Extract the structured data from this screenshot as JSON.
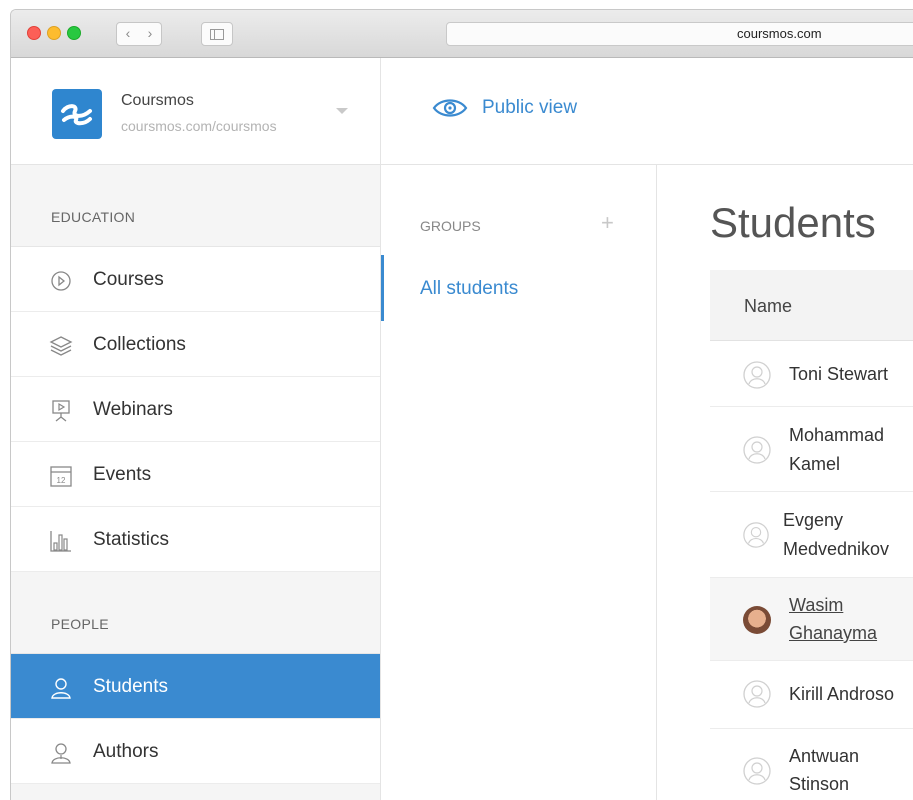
{
  "browser": {
    "url": "coursmos.com",
    "back_glyph": "‹",
    "forward_glyph": "›"
  },
  "brand": {
    "name": "Coursmos",
    "url": "coursmos.com/coursmos",
    "logo_color": "#2f86cf"
  },
  "topbar": {
    "public_view_label": "Public view"
  },
  "sidebar": {
    "sections": [
      {
        "title": "EDUCATION",
        "items": [
          {
            "label": "Courses",
            "icon": "play-circle-icon"
          },
          {
            "label": "Collections",
            "icon": "layers-icon"
          },
          {
            "label": "Webinars",
            "icon": "presentation-icon"
          },
          {
            "label": "Events",
            "icon": "calendar-icon",
            "calendar_day": "12"
          },
          {
            "label": "Statistics",
            "icon": "bar-chart-icon"
          }
        ]
      },
      {
        "title": "PEOPLE",
        "items": [
          {
            "label": "Students",
            "icon": "user-icon",
            "active": true
          },
          {
            "label": "Authors",
            "icon": "author-icon"
          }
        ]
      }
    ]
  },
  "groups": {
    "heading": "GROUPS",
    "add_glyph": "+",
    "items": [
      {
        "label": "All students",
        "active": true
      }
    ]
  },
  "students": {
    "title": "Students",
    "column_name": "Name",
    "rows": [
      {
        "line1": "Toni Stewart",
        "line2": ""
      },
      {
        "line1": "Mohammad",
        "line2": "Kamel"
      },
      {
        "line1": "Evgeny",
        "line2": "Medvednikov"
      },
      {
        "line1": "Wasim",
        "line2": "Ghanayma",
        "photo": true,
        "link": true
      },
      {
        "line1": "Kirill Androso",
        "line2": ""
      },
      {
        "line1": "Antwuan",
        "line2": "Stinson"
      }
    ]
  },
  "colors": {
    "accent": "#3a8ad0",
    "sidebar_bg": "#f5f5f5"
  }
}
